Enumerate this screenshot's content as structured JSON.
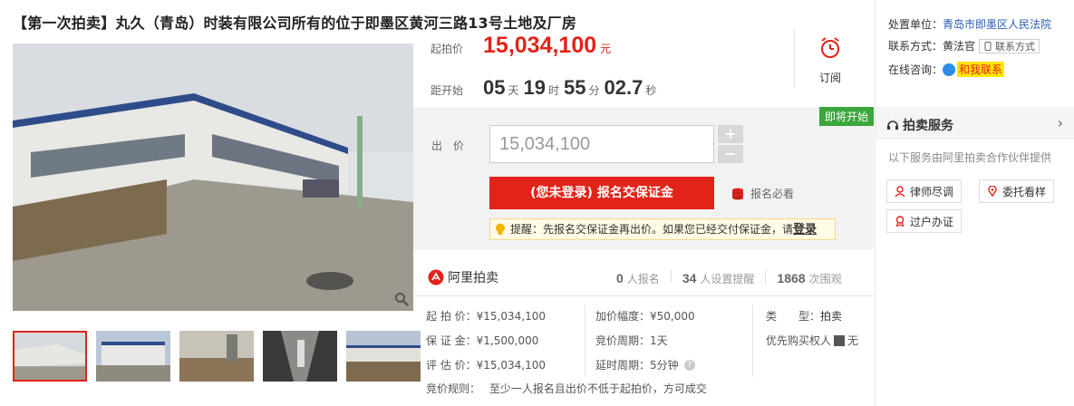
{
  "title": "【第一次拍卖】丸久（青岛）时装有限公司所有的位于即墨区黄河三路13号土地及厂房",
  "price": {
    "label": "起拍价",
    "value": "15,034,100",
    "unit": "元"
  },
  "countdown": {
    "label": "距开始",
    "days": "05",
    "days_unit": "天",
    "hours": "19",
    "hours_unit": "时",
    "minutes": "55",
    "minutes_unit": "分",
    "seconds": "02.7",
    "seconds_unit": "秒"
  },
  "subscribe": {
    "label": "订阅",
    "icon": "alarm-clock-icon"
  },
  "bid": {
    "badge": "即将开始",
    "label": "出 价",
    "value": "15,034,100",
    "plus": "+",
    "minus": "−",
    "register_button": "(您未登录) 报名交保证金",
    "must_read": "报名必看",
    "tip_text": "提醒：先报名交保证金再出价。如果您已经交付保证金，请",
    "tip_login": "登录"
  },
  "ali": {
    "logo_text": "阿里拍卖",
    "registered_count": "0",
    "registered_label": "人报名",
    "reminder_count": "34",
    "reminder_label": "人设置提醒",
    "views_count": "1868",
    "views_label": "次围观"
  },
  "details": {
    "start_price_label": "起 拍 价：",
    "start_price": "¥15,034,100",
    "increment_label": "加价幅度：",
    "increment": "¥50,000",
    "type_label": "类　　型：",
    "type": "拍卖",
    "deposit_label": "保 证 金：",
    "deposit": "¥1,500,000",
    "cycle_label": "竞价周期：",
    "cycle": "1天",
    "priority_label": "优先购买权人",
    "priority": "无",
    "appraisal_label": "评 估 价：",
    "appraisal": "¥15,034,100",
    "delay_label": "延时周期：",
    "delay": "5分钟",
    "rules_label": "竞价规则：",
    "rules": "至少一人报名且出价不低于起拍价，方可成交"
  },
  "right": {
    "court_label": "处置单位：",
    "court": "青岛市即墨区人民法院",
    "contact_label": "联系方式：",
    "contact_name": "黄法官",
    "contact_button": "联系方式",
    "chat_label": "在线咨询：",
    "chat_button": "和我联系",
    "service_title": "拍卖服务",
    "service_desc": "以下服务由阿里拍卖合作伙伴提供",
    "services": [
      "律师尽调",
      "委托看样",
      "过户办证"
    ]
  },
  "colors": {
    "accent": "#e2231a",
    "badge_green": "#3ba63b",
    "tip_bg": "#fffbe5"
  }
}
